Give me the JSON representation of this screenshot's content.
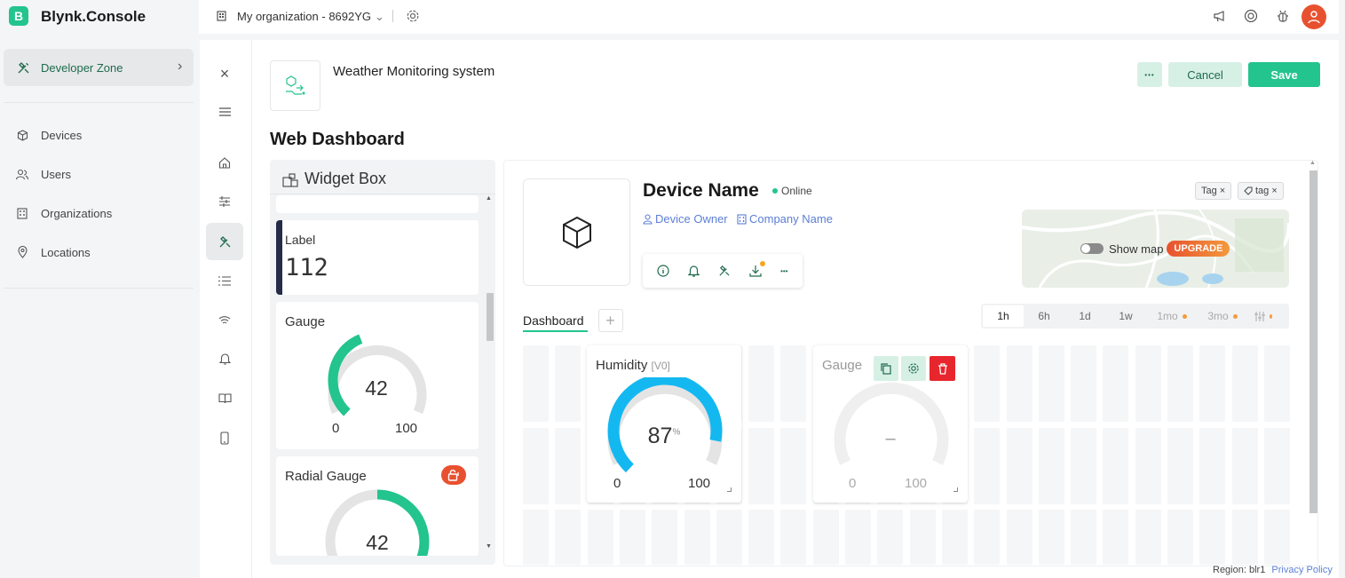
{
  "app": {
    "logo_letter": "B",
    "brand": "Blynk.Console"
  },
  "org": {
    "name": "My organization - 8692YG"
  },
  "sidebar": {
    "dev_zone": "Developer Zone",
    "items": [
      {
        "label": "Devices",
        "icon": "cube-icon"
      },
      {
        "label": "Users",
        "icon": "users-icon"
      },
      {
        "label": "Organizations",
        "icon": "building-icon"
      },
      {
        "label": "Locations",
        "icon": "pin-icon"
      }
    ]
  },
  "template": {
    "name": "Weather Monitoring system"
  },
  "actions": {
    "more": "•••",
    "cancel": "Cancel",
    "save": "Save"
  },
  "page_title": "Web Dashboard",
  "widget_box": {
    "title": "Widget Box",
    "label_widget": {
      "title": "Label",
      "value": "112"
    },
    "gauge_widget": {
      "title": "Gauge",
      "value": "42",
      "min": "0",
      "max": "100",
      "level": 0.42
    },
    "radial_widget": {
      "title": "Radial Gauge",
      "value": "42",
      "level": 0.42
    }
  },
  "device": {
    "name": "Device Name",
    "status": "Online",
    "owner": "Device Owner",
    "company": "Company Name",
    "tags": [
      "Tag ×",
      "tag ×"
    ],
    "show_map": "Show map",
    "upgrade": "UPGRADE"
  },
  "tabs": {
    "dashboard": "Dashboard",
    "add": "+"
  },
  "ranges": [
    "1h",
    "6h",
    "1d",
    "1w",
    "1mo",
    "3mo"
  ],
  "humidity": {
    "title": "Humidity",
    "pin": "[V0]",
    "value": "87",
    "unit": "%",
    "min": "0",
    "max": "100",
    "level": 0.87
  },
  "gauge": {
    "title": "Gauge",
    "value": "–",
    "min": "0",
    "max": "100"
  },
  "footer": {
    "region": "Region: blr1",
    "privacy": "Privacy Policy"
  },
  "colors": {
    "accent": "#23c48e",
    "danger": "#e8262d",
    "link": "#5b7fd6",
    "upgrade": "#e8512f",
    "gauge_blue": "#14b8f0"
  }
}
